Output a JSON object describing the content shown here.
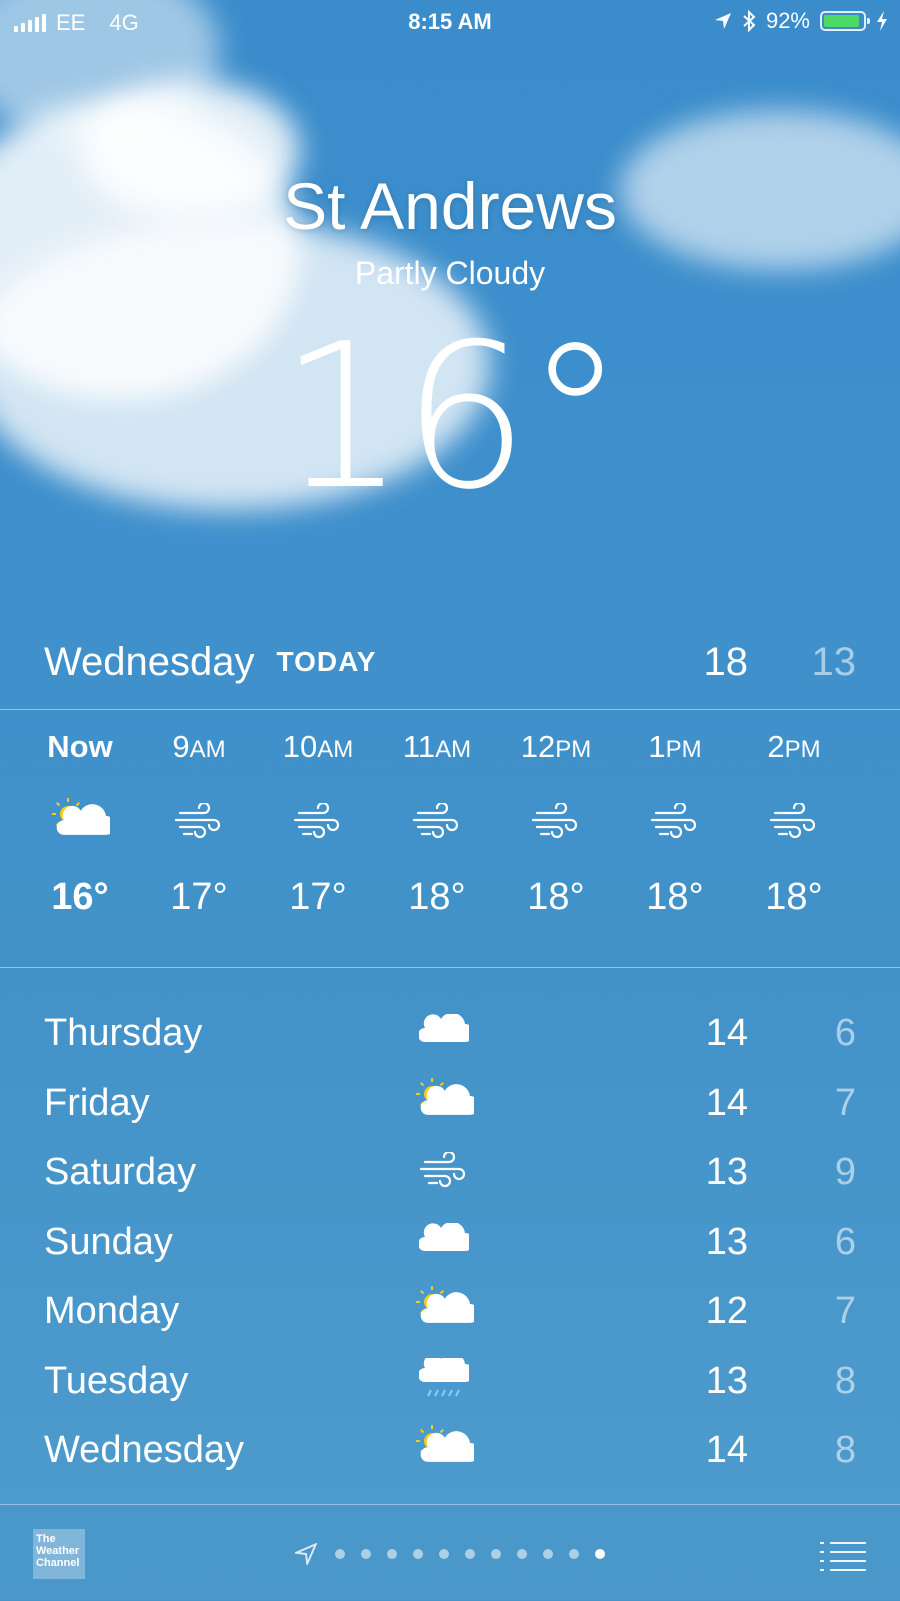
{
  "status_bar": {
    "carrier": "EE",
    "network": "4G",
    "time": "8:15 AM",
    "battery": "92%",
    "battery_level": 0.92,
    "battery_color": "#4cd964"
  },
  "location": {
    "city": "St Andrews",
    "condition": "Partly Cloudy",
    "temperature": "16°"
  },
  "today": {
    "day": "Wednesday",
    "tag": "TODAY",
    "high": "18",
    "low": "13"
  },
  "hourly": [
    {
      "time": "Now",
      "suffix": "",
      "icon": "partly-cloudy-icon",
      "temp": "16°"
    },
    {
      "time": "9",
      "suffix": "AM",
      "icon": "wind-icon",
      "temp": "17°"
    },
    {
      "time": "10",
      "suffix": "AM",
      "icon": "wind-icon",
      "temp": "17°"
    },
    {
      "time": "11",
      "suffix": "AM",
      "icon": "wind-icon",
      "temp": "18°"
    },
    {
      "time": "12",
      "suffix": "PM",
      "icon": "wind-icon",
      "temp": "18°"
    },
    {
      "time": "1",
      "suffix": "PM",
      "icon": "wind-icon",
      "temp": "18°"
    },
    {
      "time": "2",
      "suffix": "PM",
      "icon": "wind-icon",
      "temp": "18°"
    }
  ],
  "daily": [
    {
      "day": "Thursday",
      "icon": "cloud-icon",
      "high": "14",
      "low": "6"
    },
    {
      "day": "Friday",
      "icon": "partly-cloudy-icon",
      "high": "14",
      "low": "7"
    },
    {
      "day": "Saturday",
      "icon": "wind-icon",
      "high": "13",
      "low": "9"
    },
    {
      "day": "Sunday",
      "icon": "cloud-icon",
      "high": "13",
      "low": "6"
    },
    {
      "day": "Monday",
      "icon": "partly-cloudy-icon",
      "high": "12",
      "low": "7"
    },
    {
      "day": "Tuesday",
      "icon": "rain-icon",
      "high": "13",
      "low": "8"
    },
    {
      "day": "Wednesday",
      "icon": "partly-cloudy-icon",
      "high": "14",
      "low": "8"
    }
  ],
  "bottom_bar": {
    "logo_text": "The Weather Channel",
    "page_count": 11,
    "active_page": 10
  },
  "colors": {
    "sun": "#f7cb1e",
    "sky": "#3a8ccb",
    "rain": "#7fd0ff"
  }
}
